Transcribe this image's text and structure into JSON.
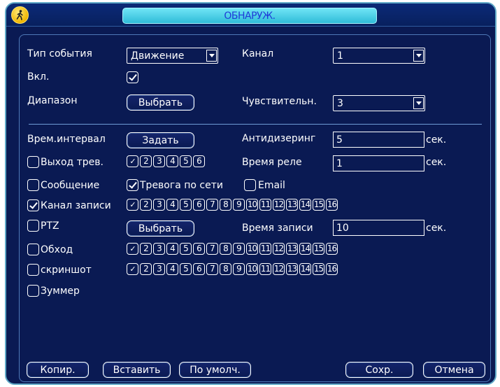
{
  "window": {
    "title": "ОБНАРУЖ."
  },
  "icons": {
    "title_icon": "walking-person-icon"
  },
  "colors": {
    "background": "#0a1a53",
    "title_box": "#2fbcd8",
    "title_text": "#1f3bd8",
    "border": "#5fa9c7"
  },
  "form": {
    "event_type": {
      "label": "Тип события",
      "value": "Движение"
    },
    "channel": {
      "label": "Канал",
      "value": "1"
    },
    "enable": {
      "label": "Вкл.",
      "checked": true
    },
    "region": {
      "label": "Диапазон",
      "button": "Выбрать"
    },
    "sensitivity": {
      "label": "Чувствительн.",
      "value": "3"
    },
    "period": {
      "label": "Врем.интервал",
      "button": "Задать"
    },
    "anti_dither": {
      "label": "Антидизеринг",
      "value": "5",
      "unit": "сек."
    },
    "alarm_out": {
      "label": "Выход трев.",
      "checked": false,
      "channels": [
        "1",
        "2",
        "3",
        "4",
        "5",
        "6"
      ],
      "checked_channels": [
        1
      ]
    },
    "relay_time": {
      "label": "Время реле",
      "value": "1",
      "unit": "сек."
    },
    "message": {
      "label": "Сообщение",
      "checked": false
    },
    "net_alarm": {
      "label": "Тревога по сети",
      "checked": true
    },
    "email": {
      "label": "Email",
      "checked": false
    },
    "record_channel": {
      "label": "Канал записи",
      "checked": true,
      "channels": [
        "1",
        "2",
        "3",
        "4",
        "5",
        "6",
        "7",
        "8",
        "9",
        "10",
        "11",
        "12",
        "13",
        "14",
        "15",
        "16"
      ],
      "checked_channels": [
        1
      ]
    },
    "ptz": {
      "label": "PTZ",
      "checked": false,
      "button": "Выбрать"
    },
    "record_time": {
      "label": "Время записи",
      "value": "10",
      "unit": "сек."
    },
    "tour": {
      "label": "Обход",
      "checked": false,
      "channels": [
        "1",
        "2",
        "3",
        "4",
        "5",
        "6",
        "7",
        "8",
        "9",
        "10",
        "11",
        "12",
        "13",
        "14",
        "15",
        "16"
      ],
      "checked_channels": [
        1
      ]
    },
    "snapshot": {
      "label": "скриншот",
      "checked": false,
      "channels": [
        "1",
        "2",
        "3",
        "4",
        "5",
        "6",
        "7",
        "8",
        "9",
        "10",
        "11",
        "12",
        "13",
        "14",
        "15",
        "16"
      ],
      "checked_channels": [
        1
      ]
    },
    "buzzer": {
      "label": "Зуммер",
      "checked": false
    }
  },
  "footer": {
    "copy": "Копир.",
    "paste": "Вставить",
    "default": "По умолч.",
    "save": "Сохр.",
    "cancel": "Отмена"
  }
}
